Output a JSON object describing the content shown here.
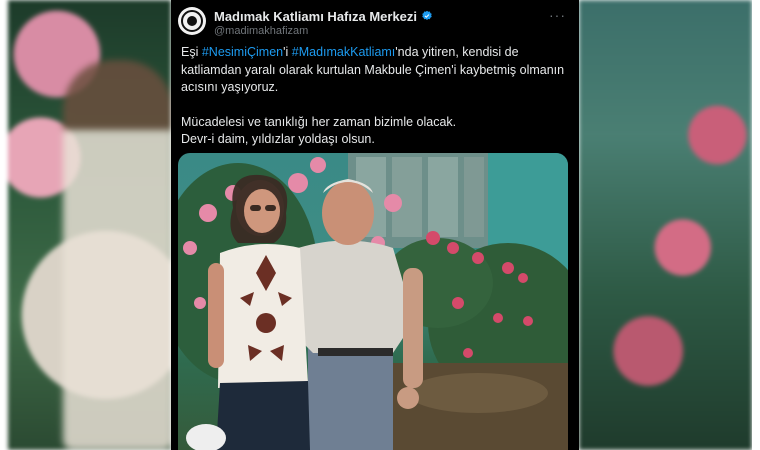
{
  "tweet": {
    "account": {
      "name": "Madımak Katliamı Hafıza Merkezi",
      "handle": "@madimakhafizam",
      "verified": true,
      "avatar_icon": "madimak-logo-icon"
    },
    "more_label": "···",
    "text": {
      "line1_prefix": "Eşi ",
      "hashtag1": "#NesimiÇimen",
      "line1_mid": "'i ",
      "hashtag2": "#MadımakKatliamı",
      "line1_rest": "'nda yitiren, kendisi de katliamdan yaralı olarak kurtulan Makbule Çimen'i kaybetmiş olmanın acısını yaşıyoruz.",
      "paragraph2_line1": "Mücadelesi ve tanıklığı her zaman bizimle olacak.",
      "paragraph2_line2": "Devr-i daim, yıldızlar yoldaşı olsun."
    },
    "photo_icon": "couple-photo-icon"
  },
  "colors": {
    "background": "#000000",
    "text": "#e7e9ea",
    "secondary_text": "#71767b",
    "hashtag": "#1d9bf0",
    "verified_badge": "#1d9bf0"
  }
}
